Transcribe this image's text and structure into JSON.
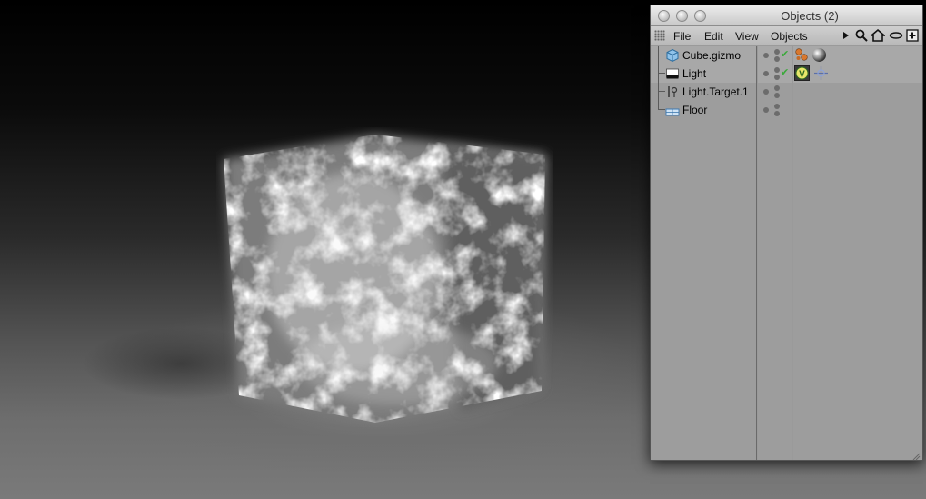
{
  "window": {
    "title": "Objects (2)"
  },
  "menu": {
    "items": [
      "File",
      "Edit",
      "View",
      "Objects"
    ]
  },
  "toolbar_icons": [
    "arrow-right-icon",
    "search-icon",
    "home-icon",
    "eye-icon",
    "add-icon"
  ],
  "objects": [
    {
      "label": "Cube.gizmo",
      "icon": "cube-icon",
      "selected": true,
      "has_check": true,
      "tags": [
        "spheres-tag-icon",
        "material-sphere-icon"
      ]
    },
    {
      "label": "Light",
      "icon": "light-icon",
      "selected": true,
      "has_check": true,
      "tags": [
        "vray-tag-icon",
        "target-tag-icon"
      ]
    },
    {
      "label": "Light.Target.1",
      "icon": "null-target-icon",
      "selected": false,
      "has_check": false,
      "tags": []
    },
    {
      "label": "Floor",
      "icon": "floor-icon",
      "selected": false,
      "has_check": false,
      "tags": []
    }
  ],
  "colors": {
    "window_bg": "#9a9a9a",
    "selected_row": "#a8a8a8",
    "check": "#3aa93a"
  }
}
